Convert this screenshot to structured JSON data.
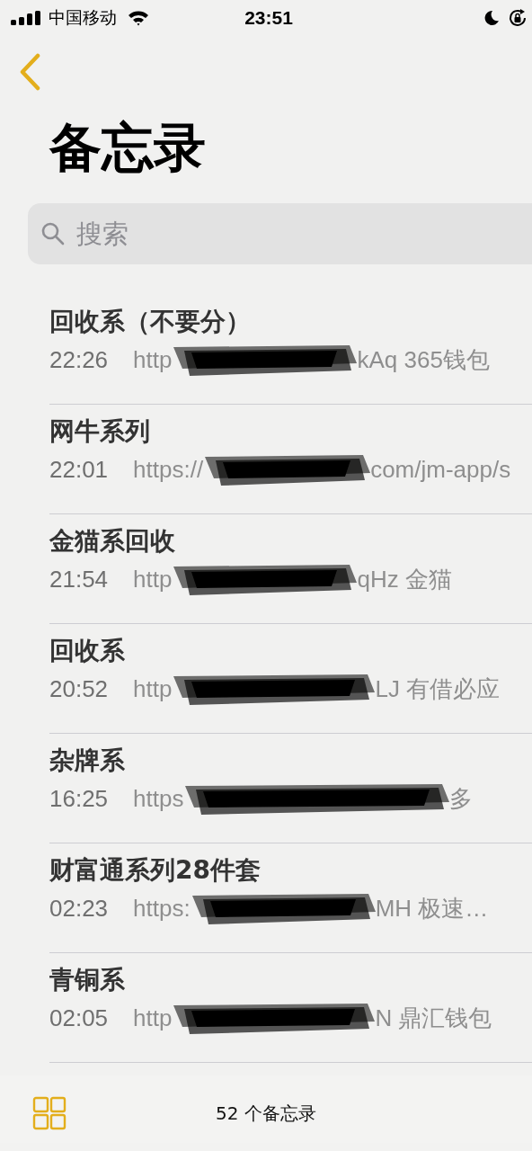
{
  "status_bar": {
    "carrier": "中国移动",
    "time": "23:51"
  },
  "title": "备忘录",
  "search": {
    "placeholder": "搜索"
  },
  "notes": [
    {
      "title": "回收系（不要分）",
      "time": "22:26",
      "preview_start": "http",
      "preview_end": "kAq 365钱包"
    },
    {
      "title": "网牛系列",
      "time": "22:01",
      "preview_start": "https://",
      "preview_end": "com/jm-app/s"
    },
    {
      "title": "金猫系回收",
      "time": "21:54",
      "preview_start": "http",
      "preview_end": "qHz 金猫"
    },
    {
      "title": "回收系",
      "time": "20:52",
      "preview_start": "http",
      "preview_end": "LJ 有借必应"
    },
    {
      "title": "杂牌系",
      "time": "16:25",
      "preview_start": "https",
      "preview_end": "多"
    },
    {
      "title": "财富通系列28件套",
      "time": "02:23",
      "preview_start": "https:",
      "preview_end": "MH 极速…"
    },
    {
      "title": "青铜系",
      "time": "02:05",
      "preview_start": "http",
      "preview_end": "N 鼎汇钱包"
    }
  ],
  "toolbar": {
    "count": "52 个备忘录"
  }
}
